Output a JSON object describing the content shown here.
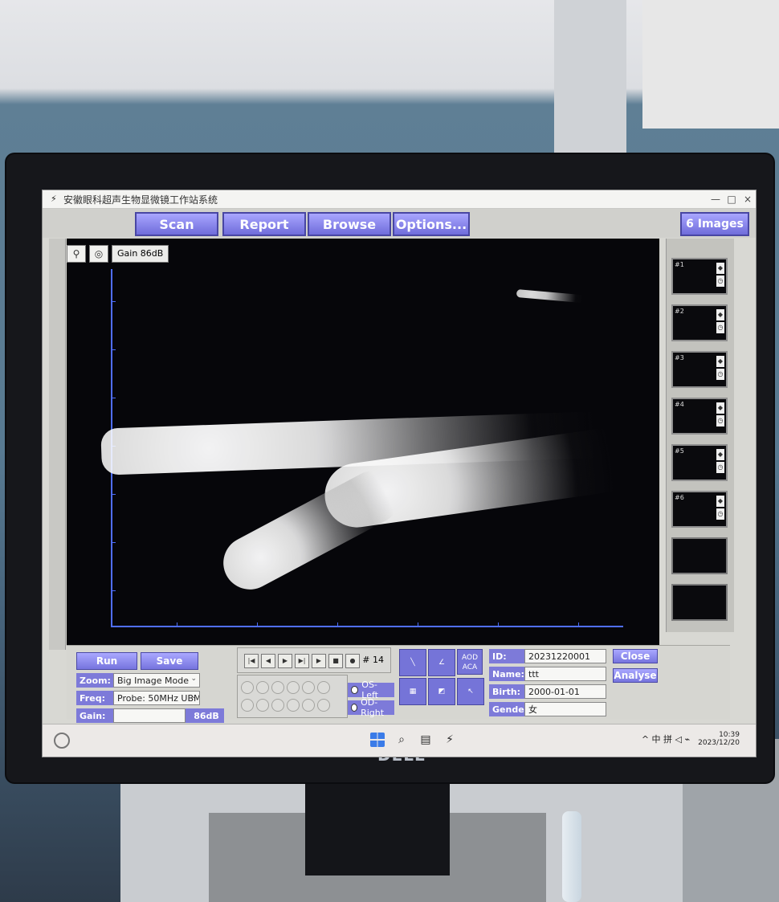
{
  "app": {
    "title": "安徽眼科超声生物显微镜工作站系统",
    "window_controls": [
      "—",
      "□",
      "×"
    ]
  },
  "menu": {
    "scan": "Scan",
    "report": "Report",
    "browse": "Browse",
    "options": "Options...",
    "images": "6 Images"
  },
  "viewer": {
    "gain_label": "Gain 86dB",
    "thumbs": [
      "#1",
      "#2",
      "#3",
      "#4",
      "#5",
      "#6"
    ]
  },
  "controls": {
    "run": "Run",
    "save": "Save",
    "zoom_label": "Zoom:",
    "zoom_value": "Big Image Mode",
    "freq_label": "Freq:",
    "freq_value": "Probe: 50MHz UBM",
    "gain_label": "Gain:",
    "gain_value": "86dB",
    "frame": "# 14",
    "os_left": "OS-Left",
    "od_right": "OD-Right",
    "aod": "AOD",
    "aca": "ACA"
  },
  "patient": {
    "id_label": "ID:",
    "id_value": "20231220001",
    "name_label": "Name:",
    "name_value": "ttt",
    "birth_label": "Birth:",
    "birth_value": "2000-01-01",
    "gender_label": "Gender",
    "gender_value": "女",
    "close": "Close",
    "analyse": "Analyse"
  },
  "taskbar": {
    "tray_text": "^ 中 拼 ◁ ⌁",
    "time": "10:39",
    "date": "2023/12/20"
  },
  "brand": {
    "label": "DELL"
  },
  "colors": {
    "accent": "#7b78de",
    "axis": "#4f6eff",
    "background_panel": "#d8d8d3"
  }
}
